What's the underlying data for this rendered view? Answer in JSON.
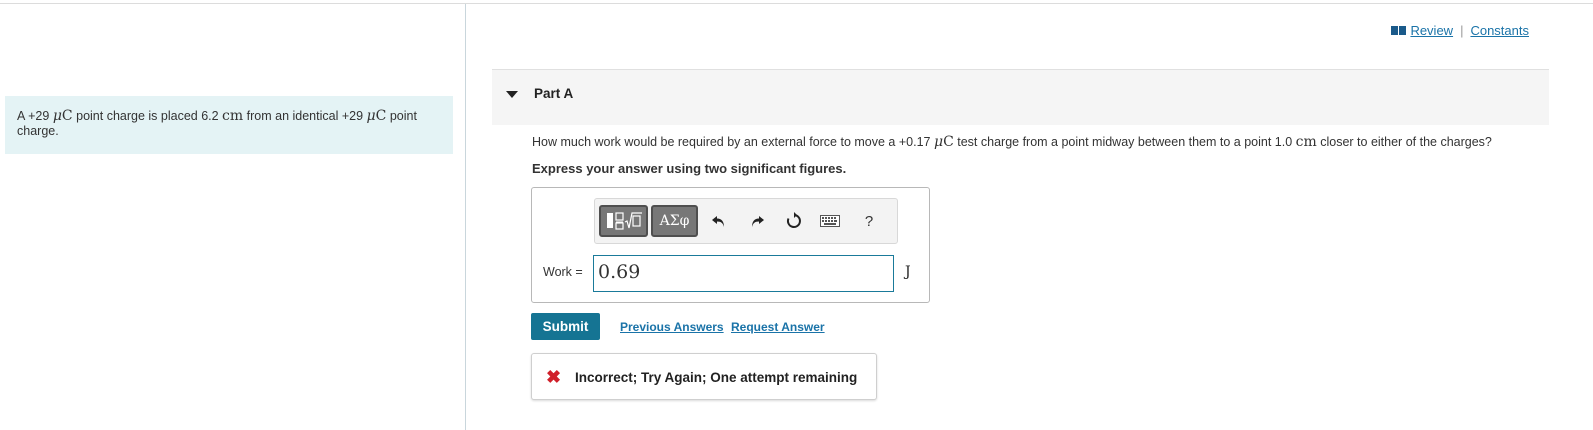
{
  "top_links": {
    "review_label": "Review",
    "separator": "|",
    "constants_label": "Constants"
  },
  "problem": {
    "prefix": "A +29 ",
    "unit_mu": "μ",
    "unit_c": "C",
    "middle_1": " point charge is placed 6.2 ",
    "unit_cm": "cm",
    "middle_2": " from an identical +29 ",
    "suffix": " point charge."
  },
  "part": {
    "title": "Part A"
  },
  "question": {
    "before": "How much work would be required by an external force to move a +0.17 ",
    "unit_mu": "μ",
    "unit_c": "C",
    "middle": " test charge from a point midway between them to a point 1.0 ",
    "unit_cm": "cm",
    "after": " closer to either of the charges?"
  },
  "instruction": "Express your answer using two significant figures.",
  "toolbar": {
    "greek_label": "ΑΣφ",
    "help_label": "?"
  },
  "answer": {
    "label": "Work =",
    "value": "0.69",
    "unit": "J"
  },
  "actions": {
    "submit_label": "Submit",
    "previous_answers": "Previous Answers",
    "request_answer": "Request Answer"
  },
  "feedback": {
    "icon": "✖",
    "text": "Incorrect; Try Again; One attempt remaining",
    "color": "#d0202a"
  }
}
